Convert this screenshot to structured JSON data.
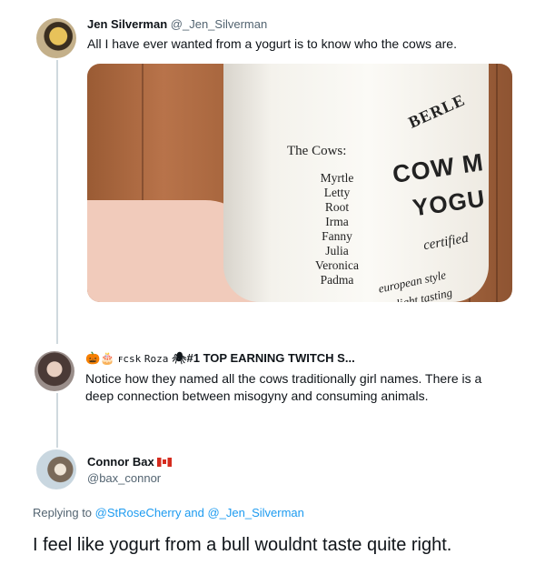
{
  "tweet1": {
    "name": "Jen Silverman",
    "handle": "@_Jen_Silverman",
    "text": "All I have ever wanted from a yogurt is to know who the cows are.",
    "image": {
      "cows_title": "The Cows:",
      "cows": [
        "Myrtle",
        "Letty",
        "Root",
        "Irma",
        "Fanny",
        "Julia",
        "Veronica",
        "Padma"
      ],
      "brand": "BERLE",
      "line1": "COW M",
      "line2": "YOGU",
      "certified": "certified",
      "european": "european style",
      "light": "light tasting"
    }
  },
  "tweet2": {
    "emoji": "🎃🎂",
    "name_tag": "ꜰcsk",
    "name": "Roza",
    "name_suffix": "#1 TOP EARNING TWITCH S...",
    "text": "Notice how they named all the cows traditionally girl names. There is a deep connection between misogyny and consuming animals."
  },
  "tweet3": {
    "name": "Connor Bax",
    "handle": "@bax_connor",
    "replying_prefix": "Replying to",
    "mention1": "@StRoseCherry",
    "and": "and",
    "mention2": "@_Jen_Silverman",
    "text": "I feel like yogurt from a bull wouldnt taste quite right."
  }
}
